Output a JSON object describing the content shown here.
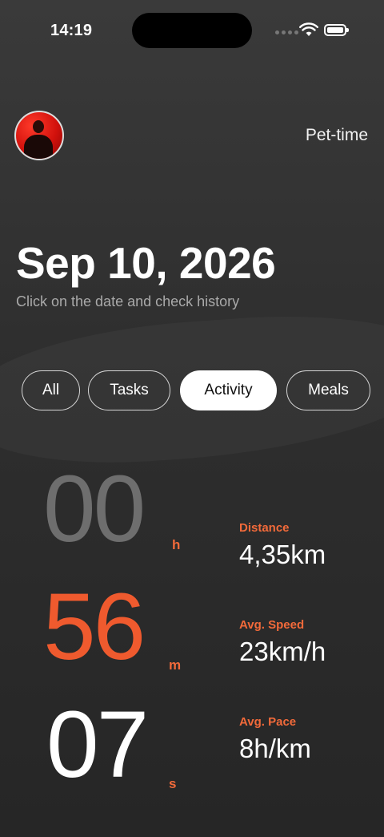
{
  "status_bar": {
    "time": "14:19"
  },
  "header": {
    "app_name": "Pet-time"
  },
  "date": {
    "title": "Sep 10, 2026",
    "hint": "Click on the date and check history"
  },
  "tabs": [
    {
      "label": "All",
      "active": false
    },
    {
      "label": "Tasks",
      "active": false
    },
    {
      "label": "Activity",
      "active": true
    },
    {
      "label": "Meals",
      "active": false
    }
  ],
  "timer": {
    "hours": "00",
    "hours_unit": "h",
    "minutes": "56",
    "minutes_unit": "m",
    "seconds": "07",
    "seconds_unit": "s"
  },
  "stats": [
    {
      "label": "Distance",
      "value": "4,35km"
    },
    {
      "label": "Avg. Speed",
      "value": "23km/h"
    },
    {
      "label": "Avg. Pace",
      "value": "8h/km"
    }
  ],
  "colors": {
    "accent": "#f26a3a",
    "minutes": "#ef5a2e",
    "hours": "#6e6e6e",
    "seconds": "#ffffff",
    "background": "#2f2f2f"
  }
}
